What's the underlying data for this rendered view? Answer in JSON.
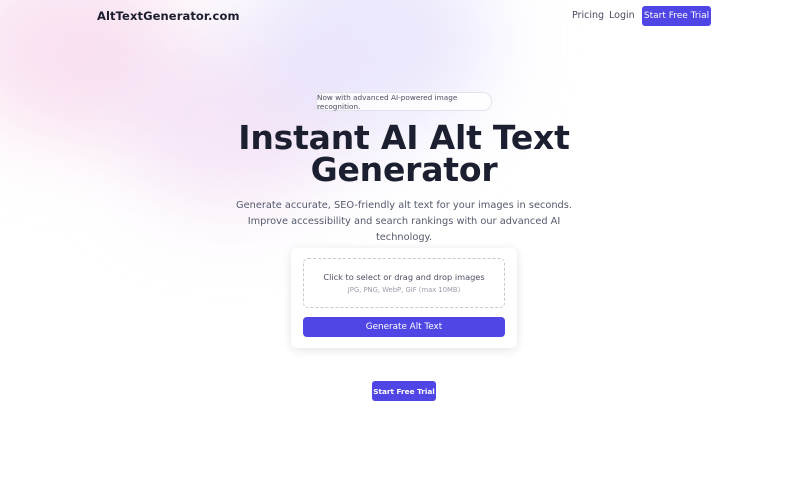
{
  "brand": {
    "name": "AltTextGenerator.com",
    "accent_color": "#4f46e5"
  },
  "nav": {
    "pricing": "Pricing",
    "login": "Login",
    "cta": "Start Free Trial"
  },
  "hero": {
    "badge": "Now with advanced AI-powered image recognition.",
    "title": "Instant AI Alt Text Generator",
    "subtitle": "Generate accurate, SEO-friendly alt text for your images in seconds. Improve accessibility and search rankings with our advanced AI technology."
  },
  "upload": {
    "prompt": "Click to select or drag and drop images",
    "hint": "JPG, PNG, WebP, GIF (max 10MB)",
    "button": "Generate Alt Text"
  },
  "footer_cta": {
    "label": "Start Free Trial"
  }
}
